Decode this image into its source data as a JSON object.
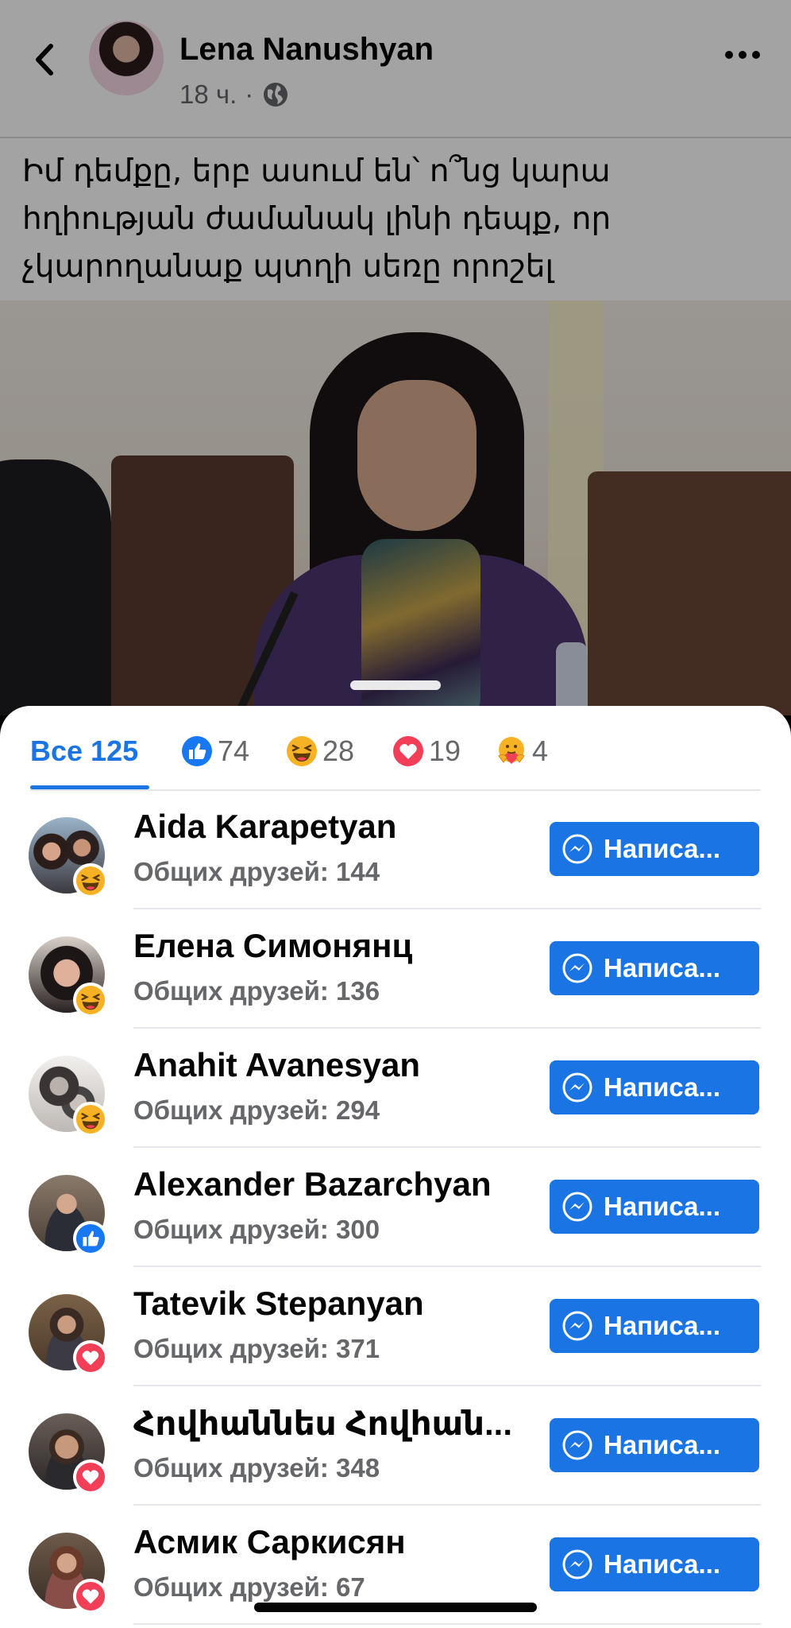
{
  "post": {
    "author": "Lena Nanushyan",
    "time": "18 ч.",
    "separator": "·",
    "text": "Իմ դեմքը, երբ ասում են՝ ո՞նց կարա հղիության ժամանակ լինի դեպք, որ չկարողանաք պտղի սեռը որոշել"
  },
  "tabs": [
    {
      "label": "Все 125",
      "icon": "",
      "active": true
    },
    {
      "label": "74",
      "icon": "like-icon"
    },
    {
      "label": "28",
      "icon": "haha-icon"
    },
    {
      "label": "19",
      "icon": "love-icon"
    },
    {
      "label": "4",
      "icon": "care-icon"
    }
  ],
  "button_label": "Написа...",
  "people": [
    {
      "name": "Aida Karapetyan",
      "mutual": "Общих друзей: 144",
      "reaction": "haha"
    },
    {
      "name": "Елена Симонянц",
      "mutual": "Общих друзей: 136",
      "reaction": "haha"
    },
    {
      "name": "Anahit Avanesyan",
      "mutual": "Общих друзей: 294",
      "reaction": "haha"
    },
    {
      "name": "Alexander Bazarchyan",
      "mutual": "Общих друзей: 300",
      "reaction": "like"
    },
    {
      "name": "Tatevik Stepanyan",
      "mutual": "Общих друзей: 371",
      "reaction": "love"
    },
    {
      "name": "Հովհաննես Հովհան...",
      "mutual": "Общих друзей: 348",
      "reaction": "love"
    },
    {
      "name": "Асмик Саркисян",
      "mutual": "Общих друзей: 67",
      "reaction": "love"
    }
  ],
  "colors": {
    "accent": "#1b74e4",
    "like": "#1877f2",
    "haha": "#f7b125",
    "love": "#f33e58"
  }
}
